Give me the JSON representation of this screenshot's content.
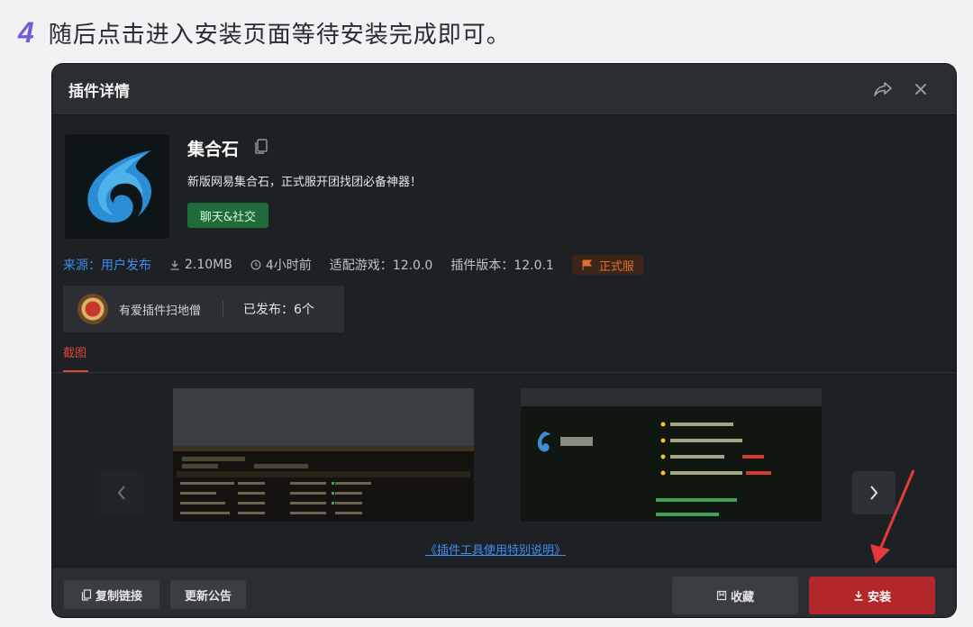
{
  "step": {
    "number": "4",
    "text": "随后点击进入安装页面等待安装完成即可。"
  },
  "dialog": {
    "title": "插件详情",
    "plugin": {
      "name": "集合石",
      "description": "新版网易集合石，正式服开团找团必备神器！",
      "category": "聊天&社交"
    },
    "meta": {
      "source": "来源：用户发布",
      "size": "2.10MB",
      "time": "4小时前",
      "game": "适配游戏：12.0.0",
      "version": "插件版本：12.0.1",
      "badge": "正式服"
    },
    "author": {
      "name": "有爱插件扫地僧",
      "published": "已发布：6个"
    },
    "tab": "截图",
    "link": "《插件工具使用特别说明》",
    "footer": {
      "copy_link": "复制链接",
      "update_notice": "更新公告",
      "favorite": "收藏",
      "install": "安装"
    }
  },
  "colors": {
    "accent_step": "#6b5ed6",
    "link": "#3d8cf2",
    "tab_active": "#e0453a",
    "official_badge": "#e0702f",
    "install_button": "#b3262a",
    "category_tag": "#1f6b3a"
  },
  "icons": [
    "share-icon",
    "close-icon",
    "copy-icon",
    "download-icon",
    "clock-icon",
    "flag-icon",
    "chevron-left-icon",
    "chevron-right-icon",
    "bookmark-icon"
  ]
}
